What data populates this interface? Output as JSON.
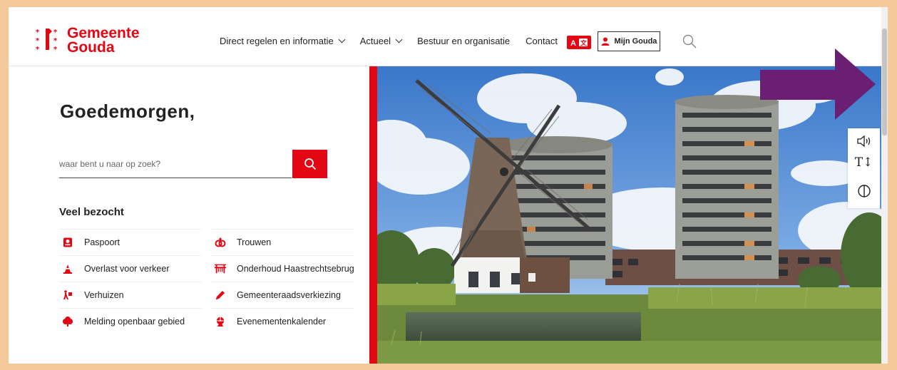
{
  "brand": {
    "name_line1": "Gemeente",
    "name_line2": "Gouda",
    "color": "#e30613"
  },
  "nav": {
    "items": [
      {
        "label": "Direct regelen en informatie",
        "has_dropdown": true
      },
      {
        "label": "Actueel",
        "has_dropdown": true
      },
      {
        "label": "Bestuur en organisatie",
        "has_dropdown": false
      },
      {
        "label": "Contact",
        "has_dropdown": false
      }
    ],
    "language_icon": "translate-icon",
    "mijn_label": "Mijn Gouda",
    "search_icon": "search-icon"
  },
  "main": {
    "greeting": "Goedemorgen,",
    "search": {
      "placeholder": "waar bent u naar op zoek?",
      "value": ""
    },
    "veel_title": "Veel bezocht",
    "veel_left": [
      {
        "label": "Paspoort",
        "icon": "passport-icon"
      },
      {
        "label": "Overlast voor verkeer",
        "icon": "traffic-cone-icon"
      },
      {
        "label": "Verhuizen",
        "icon": "moving-person-icon"
      },
      {
        "label": "Melding openbaar gebied",
        "icon": "tree-icon"
      }
    ],
    "veel_right": [
      {
        "label": "Trouwen",
        "icon": "rings-icon"
      },
      {
        "label": "Onderhoud Haastrechtsebrug",
        "icon": "bridge-icon"
      },
      {
        "label": "Gemeenteraadsverkiezing",
        "icon": "pencil-icon"
      },
      {
        "label": "Evenementenkalender",
        "icon": "ferris-wheel-icon"
      }
    ]
  },
  "accessibility": {
    "tools": [
      "read-aloud-icon",
      "text-size-icon",
      "contrast-icon"
    ],
    "text_size_glyph": "T↕"
  }
}
